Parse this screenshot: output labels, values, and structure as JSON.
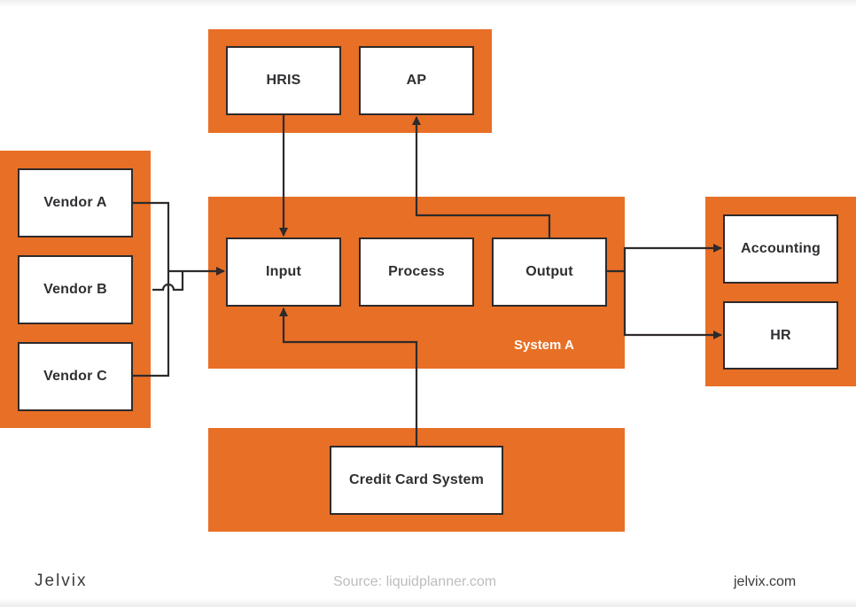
{
  "diagram": {
    "colors": {
      "group_fill": "#e86f26",
      "node_fill": "#ffffff",
      "line": "#2e2a2a"
    },
    "groups": {
      "top": {
        "nodes": [
          "HRIS",
          "AP"
        ]
      },
      "vendors": {
        "nodes": [
          "Vendor A",
          "Vendor B",
          "Vendor C"
        ]
      },
      "system_a": {
        "label": "System A",
        "nodes": [
          "Input",
          "Process",
          "Output"
        ]
      },
      "destinations": {
        "nodes": [
          "Accounting",
          "HR"
        ]
      },
      "bottom": {
        "nodes": [
          "Credit Card System"
        ]
      }
    },
    "edges": [
      {
        "from": "HRIS",
        "to": "Input"
      },
      {
        "from": "Output",
        "to": "AP"
      },
      {
        "from": "Vendor A",
        "to": "Input"
      },
      {
        "from": "Vendor B",
        "to": "Input"
      },
      {
        "from": "Vendor C",
        "to": "Input"
      },
      {
        "from": "Output",
        "to": "Accounting"
      },
      {
        "from": "Output",
        "to": "HR"
      },
      {
        "from": "Credit Card System",
        "to": "Input"
      }
    ]
  },
  "footer": {
    "logo": "Jelvix",
    "source": "Source: liquidplanner.com",
    "site": "jelvix.com"
  }
}
